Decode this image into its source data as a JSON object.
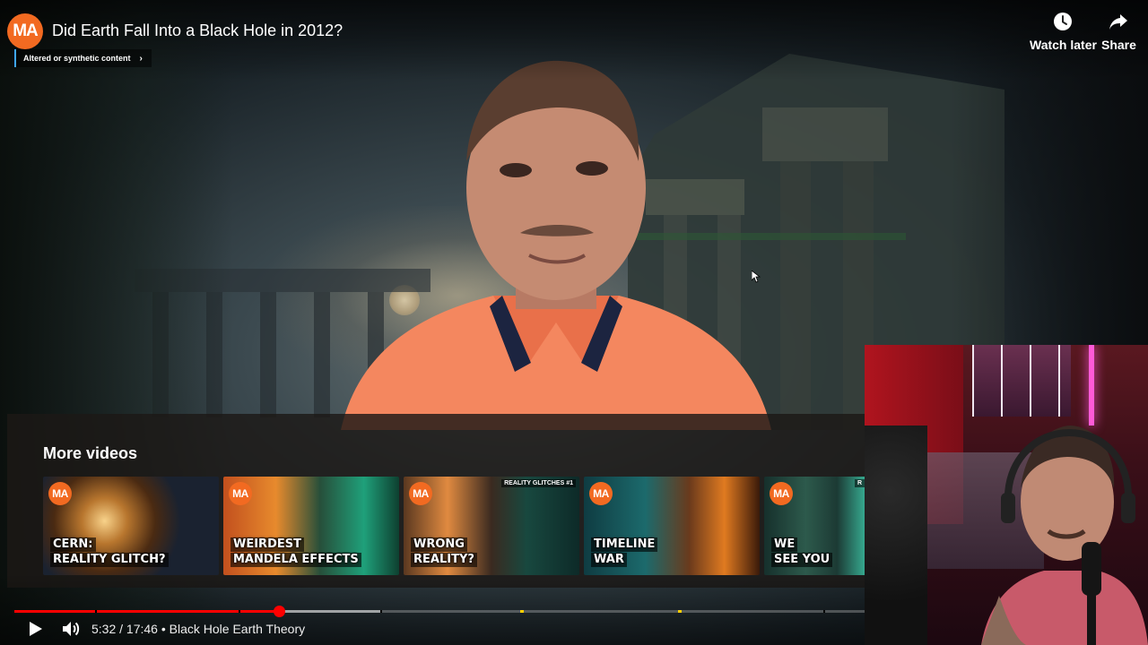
{
  "header": {
    "channel_logo_text": "MA",
    "title": "Did Earth Fall Into a Black Hole in 2012?",
    "synthetic_label": "Altered or synthetic content",
    "watch_later": "Watch later",
    "share": "Share"
  },
  "more_videos": {
    "heading": "More videos",
    "items": [
      {
        "badge": "MA",
        "lines": [
          "CERN:",
          "REALITY GLITCH?"
        ],
        "tag": ""
      },
      {
        "badge": "MA",
        "lines": [
          "WEIRDEST",
          "MANDELA EFFECTS"
        ],
        "tag": ""
      },
      {
        "badge": "MA",
        "lines": [
          "WRONG",
          "REALITY?"
        ],
        "tag": "REALITY GLITCHES #1"
      },
      {
        "badge": "MA",
        "lines": [
          "TIMELINE",
          "WAR"
        ],
        "tag": ""
      },
      {
        "badge": "MA",
        "lines": [
          "WE",
          "SEE YOU"
        ],
        "tag": "R"
      }
    ]
  },
  "player": {
    "current_time": "5:32",
    "duration": "17:46",
    "chapter": "Black Hole Earth Theory",
    "time_display": "5:32 / 17:46 • Black Hole Earth Theory",
    "played_fraction": 0.3114,
    "buffered_fraction": 0.43
  },
  "colors": {
    "brand_orange": "#f26a21",
    "progress_red": "#ff0000",
    "synthetic_accent": "#3ea6ff"
  },
  "icons": [
    "clock-icon",
    "share-arrow-icon",
    "play-icon",
    "volume-icon",
    "chevron-right-icon"
  ]
}
